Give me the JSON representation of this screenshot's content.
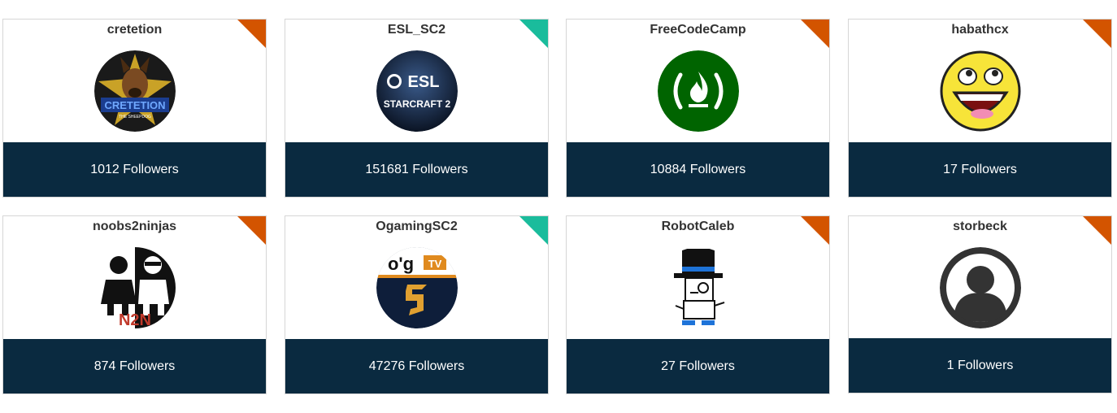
{
  "status_colors": {
    "offline": "#d35400",
    "online": "#1abc9c"
  },
  "followers_suffix": "Followers",
  "channels": [
    {
      "name": "cretetion",
      "followers": "1012",
      "status": "offline",
      "avatar_icon": "cretetion-dog-logo-icon"
    },
    {
      "name": "ESL_SC2",
      "followers": "151681",
      "status": "online",
      "avatar_icon": "esl-starcraft2-logo-icon"
    },
    {
      "name": "FreeCodeCamp",
      "followers": "10884",
      "status": "offline",
      "avatar_icon": "freecodecamp-logo-icon"
    },
    {
      "name": "habathcx",
      "followers": "17",
      "status": "offline",
      "avatar_icon": "awesome-face-icon"
    },
    {
      "name": "noobs2ninjas",
      "followers": "874",
      "status": "offline",
      "avatar_icon": "noobs2ninjas-logo-icon"
    },
    {
      "name": "OgamingSC2",
      "followers": "47276",
      "status": "online",
      "avatar_icon": "ogaming-tv-logo-icon"
    },
    {
      "name": "RobotCaleb",
      "followers": "27",
      "status": "offline",
      "avatar_icon": "robot-top-hat-icon"
    },
    {
      "name": "storbeck",
      "followers": "1",
      "status": "offline",
      "avatar_icon": "default-user-avatar-icon"
    }
  ]
}
